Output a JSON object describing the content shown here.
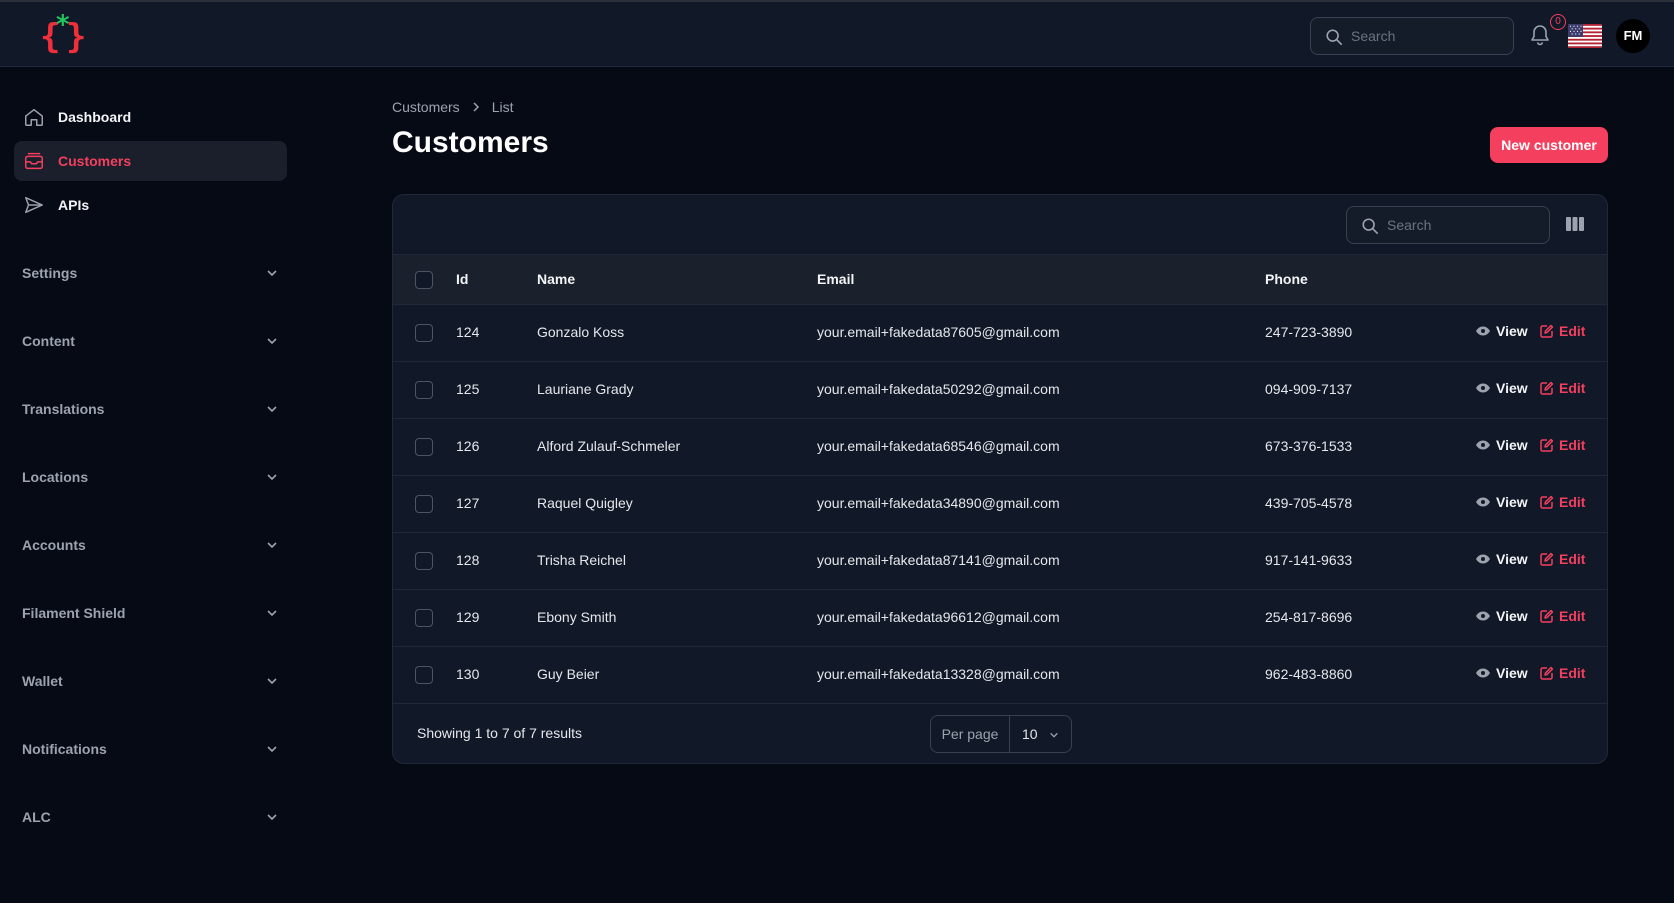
{
  "header": {
    "search_placeholder": "Search",
    "notification_count": "0",
    "avatar_initials": "FM",
    "logo_icon": "curly-braces-star-logo",
    "language_icon": "us-flag-icon"
  },
  "sidebar": {
    "items": [
      {
        "label": "Dashboard",
        "icon": "home-icon",
        "active": false
      },
      {
        "label": "Customers",
        "icon": "inbox-icon",
        "active": true
      },
      {
        "label": "APIs",
        "icon": "paper-plane-icon",
        "active": false
      }
    ],
    "groups": [
      "Settings",
      "Content",
      "Translations",
      "Locations",
      "Accounts",
      "Filament Shield",
      "Wallet",
      "Notifications",
      "ALC"
    ]
  },
  "breadcrumb": {
    "parent": "Customers",
    "current": "List"
  },
  "page": {
    "title": "Customers",
    "new_button": "New customer"
  },
  "table": {
    "search_placeholder": "Search",
    "columns": {
      "id": "Id",
      "name": "Name",
      "email": "Email",
      "phone": "Phone"
    },
    "actions": {
      "view": "View",
      "edit": "Edit"
    },
    "rows": [
      {
        "id": "124",
        "name": "Gonzalo Koss",
        "email": "your.email+fakedata87605@gmail.com",
        "phone": "247-723-3890"
      },
      {
        "id": "125",
        "name": "Lauriane Grady",
        "email": "your.email+fakedata50292@gmail.com",
        "phone": "094-909-7137"
      },
      {
        "id": "126",
        "name": "Alford Zulauf-Schmeler",
        "email": "your.email+fakedata68546@gmail.com",
        "phone": "673-376-1533"
      },
      {
        "id": "127",
        "name": "Raquel Quigley",
        "email": "your.email+fakedata34890@gmail.com",
        "phone": "439-705-4578"
      },
      {
        "id": "128",
        "name": "Trisha Reichel",
        "email": "your.email+fakedata87141@gmail.com",
        "phone": "917-141-9633"
      },
      {
        "id": "129",
        "name": "Ebony Smith",
        "email": "your.email+fakedata96612@gmail.com",
        "phone": "254-817-8696"
      },
      {
        "id": "130",
        "name": "Guy Beier",
        "email": "your.email+fakedata13328@gmail.com",
        "phone": "962-483-8860"
      }
    ],
    "footer": {
      "results_text": "Showing 1 to 7 of 7 results",
      "per_page_label": "Per page",
      "per_page_value": "10"
    }
  },
  "colors": {
    "accent": "#f43f5e",
    "background": "#060a15",
    "panel": "#111827",
    "logo_green": "#22c55e"
  }
}
